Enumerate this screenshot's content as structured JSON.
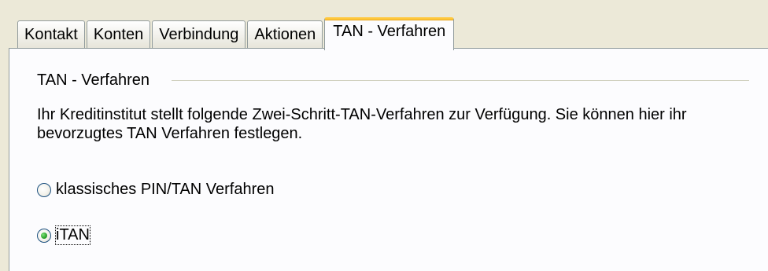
{
  "tabs": [
    {
      "label": "Kontakt",
      "active": false
    },
    {
      "label": "Konten",
      "active": false
    },
    {
      "label": "Verbindung",
      "active": false
    },
    {
      "label": "Aktionen",
      "active": false
    },
    {
      "label": "TAN - Verfahren",
      "active": true
    }
  ],
  "panel": {
    "group_title": "TAN - Verfahren",
    "description_line1": "Ihr Kreditinstitut stellt folgende Zwei-Schritt-TAN-Verfahren zur Verfügung. Sie können hier ihr",
    "description_line2": "bevorzugtes TAN Verfahren festlegen.",
    "options": [
      {
        "label": "klassisches PIN/TAN Verfahren",
        "selected": false
      },
      {
        "label": "iTAN",
        "selected": true
      }
    ]
  },
  "colors": {
    "window_bg": "#ECE9D8",
    "panel_bg": "#FCFCFE",
    "active_tab_accent": "#FFC83C",
    "radio_selected_dot": "#2BA32B"
  },
  "icons": {
    "radio_unselected": "radio-unchecked-icon",
    "radio_selected": "radio-checked-icon"
  }
}
